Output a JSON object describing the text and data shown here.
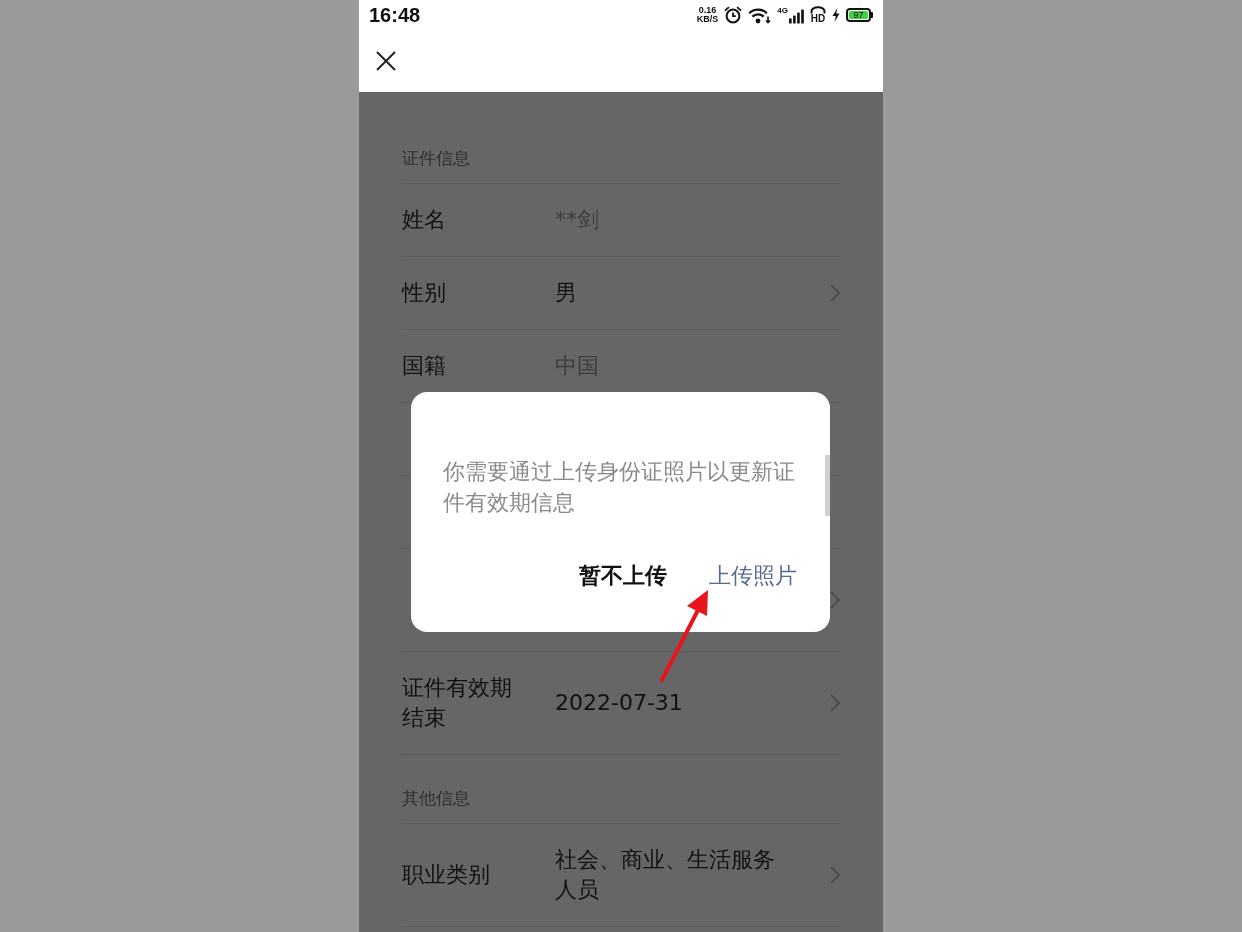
{
  "status_bar": {
    "time": "16:48",
    "net_speed": {
      "value": "0.16",
      "unit": "KB/S"
    },
    "network": "4G",
    "hd": "HD",
    "battery": "97"
  },
  "sections": [
    {
      "title": "证件信息",
      "rows": [
        {
          "kind": "field",
          "label": "姓名",
          "value": "**剑",
          "editable": false
        },
        {
          "kind": "field",
          "label": "性别",
          "value": "男",
          "editable": true
        },
        {
          "kind": "field",
          "label": "国籍",
          "value": "中国",
          "editable": false
        },
        {
          "kind": "covered",
          "editable": false
        },
        {
          "kind": "covered",
          "editable": false
        },
        {
          "kind": "covered",
          "editable": true,
          "two_line": true
        },
        {
          "kind": "field",
          "label": "证件有效期结束",
          "value": "2022-07-31",
          "editable": true
        }
      ]
    },
    {
      "title": "其他信息",
      "rows": [
        {
          "kind": "field",
          "label": "职业类别",
          "value": "社会、商业、生活服务人员",
          "editable": true
        }
      ]
    }
  ],
  "dialog": {
    "message": "你需要通过上传身份证照片以更新证件有效期信息",
    "buttons": [
      {
        "label": "暂不上传",
        "kind": "cancel"
      },
      {
        "label": "上传照片",
        "kind": "confirm"
      }
    ]
  }
}
